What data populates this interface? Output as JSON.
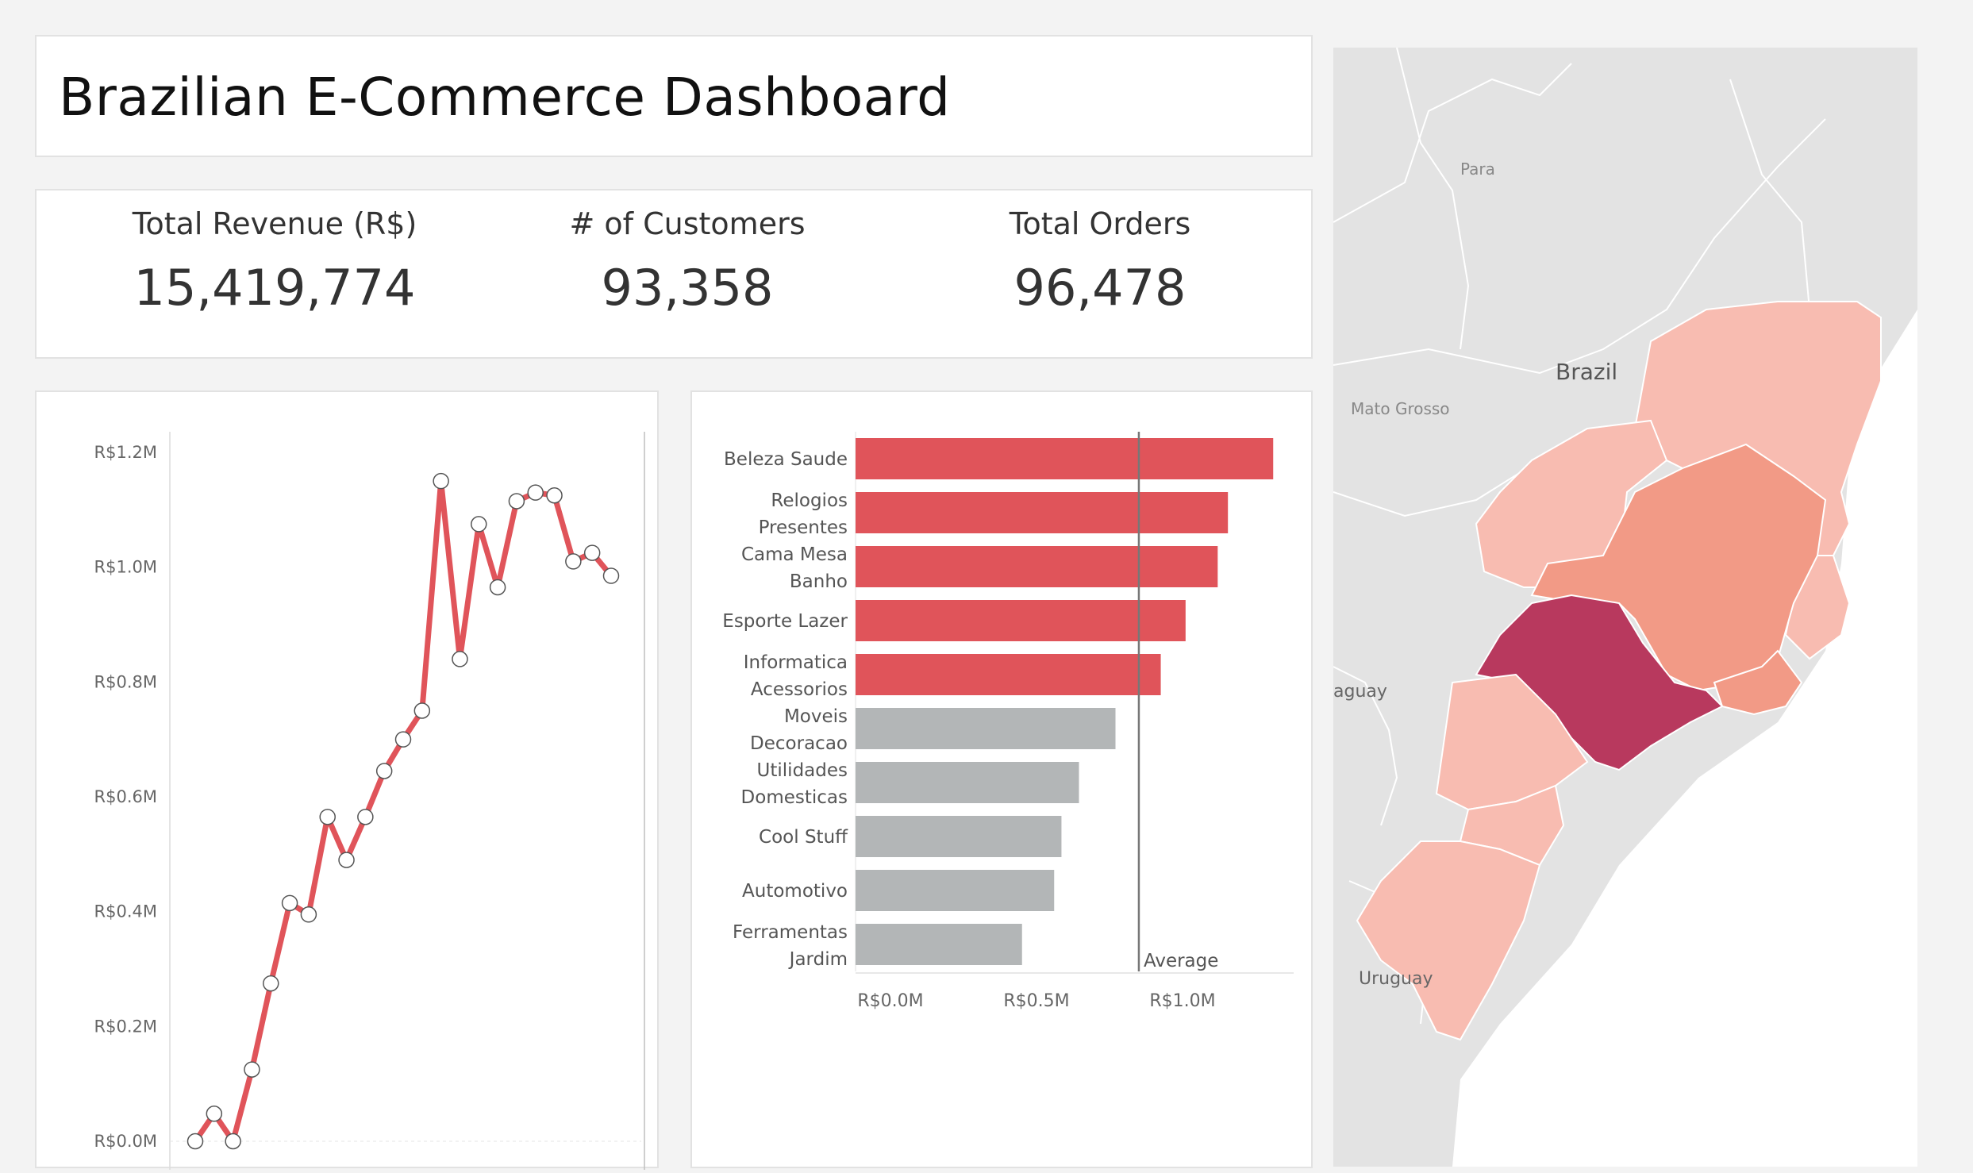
{
  "title": "Brazilian E-Commerce Dashboard",
  "kpis": [
    {
      "label": "Total Revenue (R$)",
      "value": "15,419,774"
    },
    {
      "label": "# of Customers",
      "value": "93,358"
    },
    {
      "label": "Total Orders",
      "value": "96,478"
    }
  ],
  "colors": {
    "line": "#e0545a",
    "bar_highlight": "#e0545a",
    "bar_default": "#b3b6b7",
    "sao_paulo": "#b8395e",
    "state_mid": "#f29a86",
    "state_light": "#f8bcb1",
    "map_bg": "#e3e3e3"
  },
  "chart_data": [
    {
      "type": "line",
      "title": "",
      "xlabel": "",
      "ylabel": "",
      "ylim": [
        0,
        1200000
      ],
      "ytick_labels": [
        "R$0.0M",
        "R$0.2M",
        "R$0.4M",
        "R$0.6M",
        "R$0.8M",
        "R$1.0M",
        "R$1.2M"
      ],
      "ytick_values": [
        0,
        200000,
        400000,
        600000,
        800000,
        1000000,
        1200000
      ],
      "values": [
        0,
        48000,
        0,
        125000,
        275000,
        415000,
        395000,
        565000,
        490000,
        565000,
        645000,
        700000,
        750000,
        1150000,
        840000,
        1075000,
        965000,
        1115000,
        1130000,
        1125000,
        1010000,
        1025000,
        985000
      ]
    },
    {
      "type": "bar",
      "orientation": "horizontal",
      "categories": [
        "Beleza Saude",
        "Relogios Presentes",
        "Cama Mesa Banho",
        "Esporte Lazer",
        "Informatica Acessorios",
        "Moveis Decoracao",
        "Utilidades Domesticas",
        "Cool Stuff",
        "Automotivo",
        "Ferramentas Jardim"
      ],
      "category_lines": [
        [
          "Beleza Saude"
        ],
        [
          "Relogios",
          "Presentes"
        ],
        [
          "Cama Mesa",
          "Banho"
        ],
        [
          "Esporte Lazer"
        ],
        [
          "Informatica",
          "Acessorios"
        ],
        [
          "Moveis",
          "Decoracao"
        ],
        [
          "Utilidades",
          "Domesticas"
        ],
        [
          "Cool Stuff"
        ],
        [
          "Automotivo"
        ],
        [
          "Ferramentas",
          "Jardim"
        ]
      ],
      "values": [
        1430000,
        1275000,
        1240000,
        1130000,
        1045000,
        890000,
        765000,
        705000,
        680000,
        570000
      ],
      "highlighted": [
        true,
        true,
        true,
        true,
        true,
        false,
        false,
        false,
        false,
        false
      ],
      "average": 970000,
      "average_label": "Average",
      "xlim": [
        0,
        1500000
      ],
      "xtick_labels": [
        "R$0.0M",
        "R$0.5M",
        "R$1.0M"
      ],
      "xtick_values": [
        0,
        500000,
        1000000
      ]
    }
  ],
  "map": {
    "labels": {
      "para": "Para",
      "brazil": "Brazil",
      "mato_grosso": "Mato Grosso",
      "paraguay": "aguay",
      "uruguay": "Uruguay"
    }
  }
}
